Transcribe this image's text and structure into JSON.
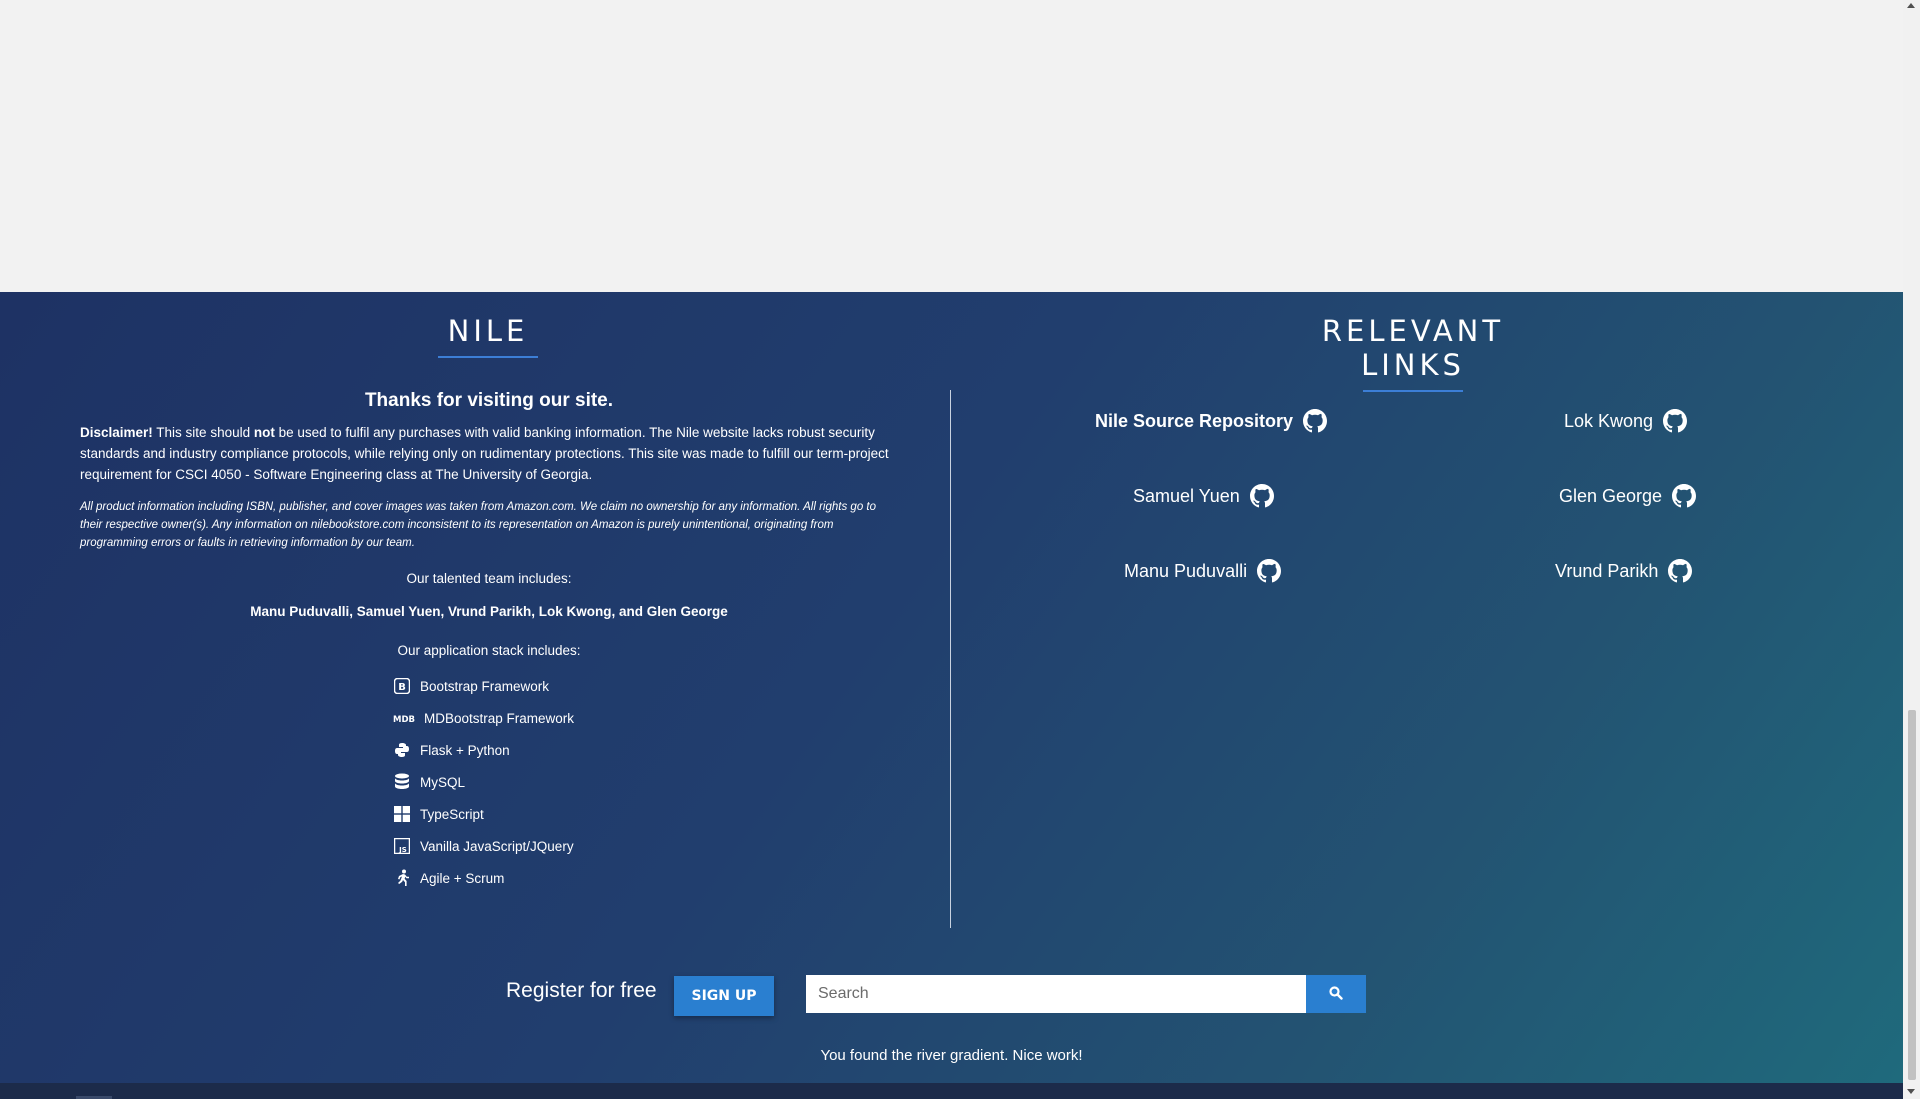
{
  "footer": {
    "nile_heading": "NILE",
    "links_heading": "RELEVANT LINKS",
    "thanks": "Thanks for visiting our site.",
    "disclaimer_label": "Disclaimer!",
    "disclaimer_part1": " This site should ",
    "disclaimer_not": "not",
    "disclaimer_part2": " be used to fulfil any purchases with valid banking information. The Nile website lacks robust security standards and industry compliance protocols, while relying only on rudimentary protections. This site was made to fulfill our term-project requirement for CSCI 4050 - Software Engineering class at The University of Georgia.",
    "credits": "All product information including ISBN, publisher, and cover images was taken from Amazon.com. We claim no ownership for any information. All rights go to their respective owner(s). Any information on nilebookstore.com inconsistent to its representation on Amazon is purely unintentional, originating from programming errors or faults in retrieving information by our team.",
    "team_intro": "Our talented team includes:",
    "team_names": "Manu Puduvalli, Samuel Yuen, Vrund Parikh, Lok Kwong, and Glen George",
    "stack_intro": "Our application stack includes:",
    "stack": [
      {
        "label": "Bootstrap Framework",
        "icon": "bootstrap-icon"
      },
      {
        "label": "MDBootstrap Framework",
        "icon": "mdb-icon"
      },
      {
        "label": "Flask + Python",
        "icon": "python-icon"
      },
      {
        "label": "MySQL",
        "icon": "database-icon"
      },
      {
        "label": "TypeScript",
        "icon": "windows-icon"
      },
      {
        "label": "Vanilla JavaScript/JQuery",
        "icon": "js-icon"
      },
      {
        "label": "Agile + Scrum",
        "icon": "running-icon"
      }
    ],
    "links": [
      {
        "label": "Nile Source Repository",
        "icon": "github-icon"
      },
      {
        "label": "Lok Kwong",
        "icon": "github-icon"
      },
      {
        "label": "Samuel Yuen",
        "icon": "github-icon"
      },
      {
        "label": "Glen George",
        "icon": "github-icon"
      },
      {
        "label": "Manu Puduvalli",
        "icon": "github-icon"
      },
      {
        "label": "Vrund Parikh",
        "icon": "github-icon"
      }
    ],
    "register_label": "Register for free",
    "signup_label": "SIGN UP",
    "search_placeholder": "Search",
    "gradient_note": "You found the river gradient. Nice work!"
  },
  "colors": {
    "accent": "#2a7fd0",
    "footer_gradient_start": "#1e3264",
    "footer_gradient_end": "#1f6a7c",
    "page_background": "#f2f2f2"
  }
}
